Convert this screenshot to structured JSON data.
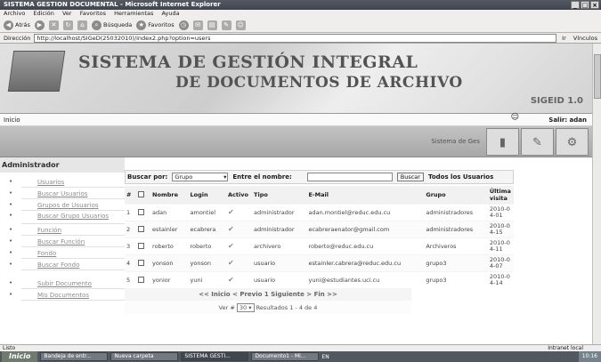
{
  "window": {
    "title": "SISTEMA GESTION DOCUMENTAL - Microsoft Internet Explorer"
  },
  "menubar": [
    "Archivo",
    "Edición",
    "Ver",
    "Favoritos",
    "Herramientas",
    "Ayuda"
  ],
  "toolbar": {
    "back": "Atrás",
    "search": "Búsqueda",
    "favorites": "Favoritos"
  },
  "address": {
    "label": "Dirección",
    "url": "http://localhost/SIGeD(25032010)/index2.php?option=users",
    "go": "Ir",
    "links": "Vínculos"
  },
  "banner": {
    "title_line1": "SISTEMA DE GESTIÓN INTEGRAL",
    "title_line2": "DE DOCUMENTOS DE ARCHIVO",
    "version": "SIGEID 1.0"
  },
  "infobar": {
    "home": "Inicio",
    "exit": "Salir: adan"
  },
  "graybar": {
    "system": "Sistema de Ges"
  },
  "sidebar": {
    "heading": "Administrador",
    "group1": [
      "Usuarios",
      "Buscar Usuarios",
      "Grupos de Usuarios",
      "Buscar Grupo Usuarios",
      "Función",
      "Buscar Función",
      "Fondo",
      "Buscar Fondo"
    ],
    "group2": [
      "Subir Documento",
      "Mis Documentos"
    ]
  },
  "search": {
    "label": "Buscar por:",
    "field": "Grupo",
    "name_label": "Entre el nombre:",
    "button": "Buscar",
    "all": "Todos los Usuarios"
  },
  "table": {
    "headers": [
      "#",
      "",
      "Nombre",
      "Login",
      "Activo",
      "Tipo",
      "E-Mail",
      "Grupo",
      "Última visita"
    ],
    "rows": [
      [
        "1",
        "adan",
        "amontiel",
        "administrador",
        "adan.montiel@reduc.edu.cu",
        "administradores",
        "2010-04-01"
      ],
      [
        "2",
        "estainler",
        "ecabrera",
        "administrador",
        "ecabreraenator@gmail.com",
        "administradores",
        "2010-04-15"
      ],
      [
        "3",
        "roberto",
        "roberto",
        "archivero",
        "roberto@reduc.edu.cu",
        "Archiveros",
        "2010-04-11"
      ],
      [
        "4",
        "yonson",
        "yonson",
        "usuario",
        "estainler.cabrera@reduc.edu.cu",
        "grupo3",
        "2010-04-07"
      ],
      [
        "5",
        "yonior",
        "yuni",
        "usuario",
        "yuni@estudiantes.uci.cu",
        "grupo3",
        "2010-04-14"
      ]
    ]
  },
  "pager": {
    "nav": "<< Inicio < Previo 1 Siguiente > Fin >>",
    "per_label": "Ver #",
    "per_value": "30",
    "results": "Resultados 1 - 4 de 4"
  },
  "statusbar": {
    "left": "Listo",
    "right": "Intranet local"
  },
  "taskbar": {
    "start": "Inicio",
    "tasks": [
      "Bandeja de entr...",
      "Nueva carpeta",
      "SISTEMA GESTI...",
      "Documento1 - Mi..."
    ],
    "lang": "EN",
    "clock": "10:16"
  }
}
